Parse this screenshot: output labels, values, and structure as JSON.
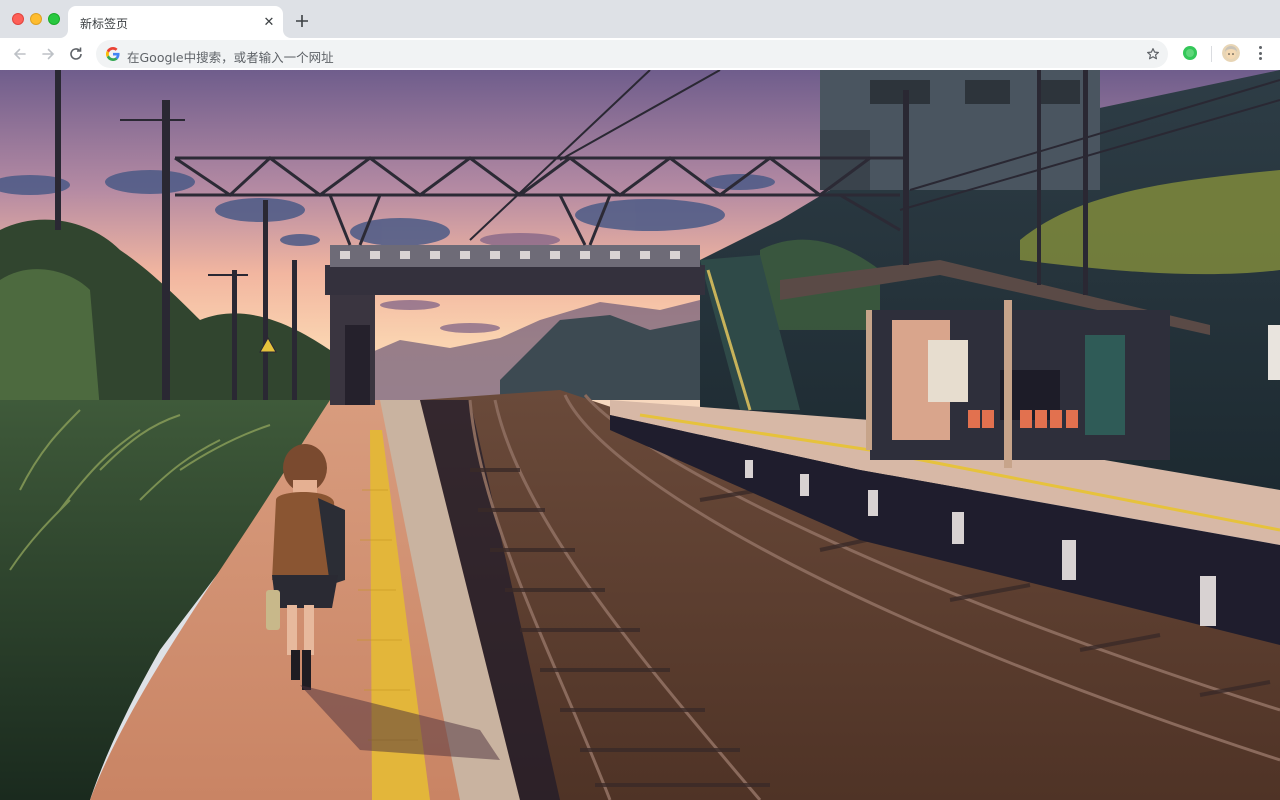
{
  "tab": {
    "title": "新标签页",
    "close_glyph": "✕"
  },
  "omnibox": {
    "placeholder": "在Google中搜索，或者输入一个网址"
  },
  "icons": {
    "back": "arrow-left-icon",
    "forward": "arrow-right-icon",
    "reload": "reload-icon",
    "new_tab": "plus-icon",
    "bookmark": "star-icon",
    "extension": "green-extension-icon",
    "profile": "avatar",
    "menu": "more-vertical-icon",
    "search_engine": "google-g-icon"
  },
  "colors": {
    "close": "#fe5f57",
    "minimize": "#febc2e",
    "maximize": "#28c840",
    "tabstrip": "#dee1e6",
    "omnibox": "#f1f3f4",
    "extension": "#34c759"
  },
  "wallpaper": {
    "description_name": "anime-train-station-sunset-wallpaper"
  }
}
